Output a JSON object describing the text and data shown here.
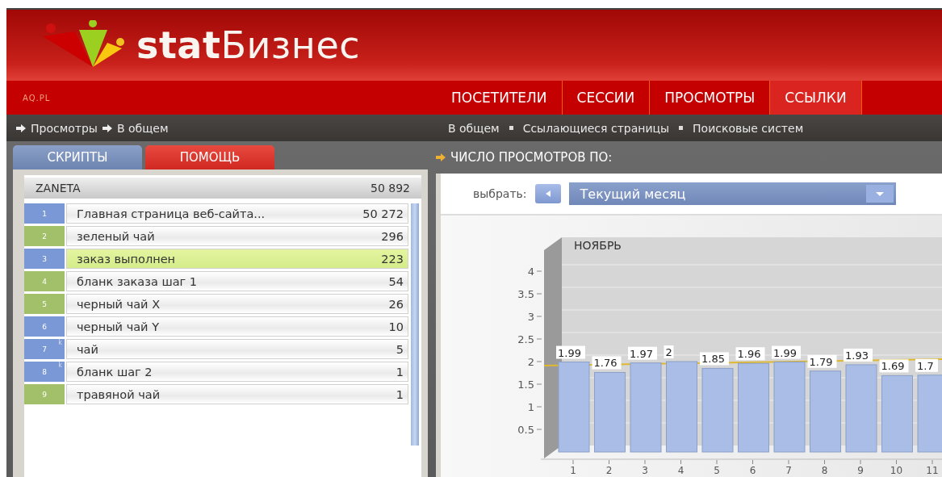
{
  "brand": {
    "bold_part": "stat",
    "rest": "Бизнес"
  },
  "site": "AQ.PL",
  "nav": [
    {
      "label": "ПОСЕТИТЕЛИ",
      "selected": false
    },
    {
      "label": "СЕССИИ",
      "selected": false
    },
    {
      "label": "ПРОСМОТРЫ",
      "selected": false
    },
    {
      "label": "ССЫЛКИ",
      "selected": true
    }
  ],
  "breadcrumbs": [
    "Просмотры",
    "В общем"
  ],
  "submenu": [
    "В общем",
    "Ссылающиеся страницы",
    "Поисковые систем"
  ],
  "side_tabs": [
    {
      "label": "СКРИПТЫ",
      "selected": true
    },
    {
      "label": "ПОМОЩЬ",
      "selected": false
    }
  ],
  "list": {
    "title": "ZANETA",
    "total": "50 892",
    "rows": [
      {
        "rank": "1",
        "name": "Главная страница веб-сайта...",
        "count": "50 272",
        "color": "#7b98d6",
        "selected": false
      },
      {
        "rank": "2",
        "name": "зеленый чай",
        "count": "296",
        "color": "#a2c06a",
        "selected": false
      },
      {
        "rank": "3",
        "name": "заказ выполнен",
        "count": "223",
        "color": "#7b98d6",
        "selected": true
      },
      {
        "rank": "4",
        "name": "бланк заказа шаг 1",
        "count": "54",
        "color": "#a2c06a",
        "selected": false
      },
      {
        "rank": "5",
        "name": "черный чай X",
        "count": "26",
        "color": "#a2c06a",
        "selected": false
      },
      {
        "rank": "6",
        "name": "черный чай Y",
        "count": "10",
        "color": "#7b98d6",
        "selected": false
      },
      {
        "rank": "7",
        "flag": "k",
        "name": "чай",
        "count": "5",
        "color": "#7b98d6",
        "selected": false
      },
      {
        "rank": "8",
        "flag": "k",
        "name": "бланк шаг 2",
        "count": "1",
        "color": "#7b98d6",
        "selected": false
      },
      {
        "rank": "9",
        "name": "травяной чай",
        "count": "1",
        "color": "#a2c06a",
        "selected": false
      }
    ]
  },
  "panel_title": "ЧИСЛО ПРОСМОТРОВ ПО:",
  "selector": {
    "label": "выбрать:",
    "value": "Текущий месяц"
  },
  "chart": {
    "chart_data": {
      "type": "bar",
      "title": "НОЯБРЬ",
      "categories": [
        "1",
        "2",
        "3",
        "4",
        "5",
        "6",
        "7",
        "8",
        "9",
        "10",
        "11"
      ],
      "series": [
        {
          "color": "#a9bde6",
          "values": [
            1.99,
            1.76,
            1.97,
            2,
            1.85,
            1.96,
            1.99,
            1.79,
            1.93,
            1.69,
            1.7
          ]
        }
      ],
      "value_labels": [
        "1.99",
        "1.76",
        "1.97",
        "2",
        "1.85",
        "1.96",
        "1.99",
        "1.79",
        "1.93",
        "1.69",
        "1.7"
      ],
      "ylim": [
        0,
        4
      ],
      "yticks": [
        0.5,
        1,
        1.5,
        2,
        2.5,
        3,
        3.5,
        4
      ]
    }
  }
}
